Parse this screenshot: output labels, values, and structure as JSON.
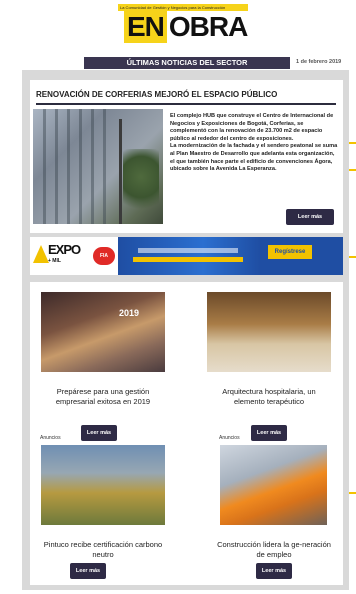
{
  "header": {
    "tagline": "La Comunidad de Gestión y Negocios para la Construcción",
    "logo_en": "EN",
    "logo_obra": "OBRA",
    "section": "ÚLTIMAS NOTICIAS DEL SECTOR",
    "date": "1 de febrero 2019"
  },
  "feature": {
    "title": "RENOVACIÓN DE CORFERIAS MEJORÓ EL ESPACIO PÚBLICO",
    "paragraph1": "El complejo HUB que construye el Centro de Internacional de Negocios y Exposiciones de Bogotá, Corferias, se complementó con la renovación de 23.700 m2 de espacio público al rededor del centro de exposiciones.",
    "paragraph2": "La modernización de la fachada y el sendero peatonal se suma al Plan Maestro de Desarrollo que adelanta esta organización, el que también hace parte el edificio de convenciones Ágora, ubicado sobre la Avenida La Esperanza.",
    "button": "Leer más"
  },
  "ad_banner": {
    "expo": "EXPO",
    "expo_sub": "+ MIL",
    "badge": "FIA",
    "right_label": "Regístrese"
  },
  "cards": [
    {
      "title": "Prepárese para una gestión empresarial exitosa en 2019",
      "button": "Leer más",
      "image_text": "2019"
    },
    {
      "title": "Arquitectura hospitalaria, un elemento terapéutico",
      "button": "Leer más"
    },
    {
      "title": "Pintuco recibe certificación carbono neutro",
      "button": "Leer más",
      "label": "Anuncios"
    },
    {
      "title": "Construcción lidera la ge-neración de empleo",
      "button": "Leer más",
      "label": "Anuncios"
    }
  ]
}
